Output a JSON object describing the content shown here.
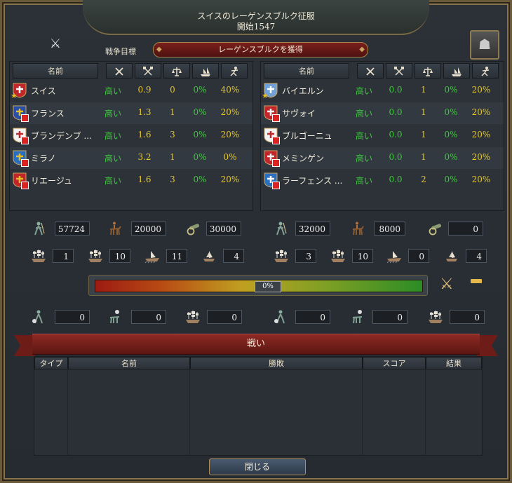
{
  "title": "スイスのレーゲンスブルク征服",
  "subtitle": "開始1547",
  "wargoal": {
    "label": "戦争目標",
    "value": "レーゲンスブルクを獲得"
  },
  "columns": {
    "name": "名前"
  },
  "attackers": [
    {
      "name": "スイス",
      "flag_color": "#c0262a",
      "flag_alt": "#ffffff",
      "leader": true,
      "v1": "高い",
      "v2": "0.9",
      "v3": "0",
      "v4": "0%",
      "v5": "40%"
    },
    {
      "name": "フランス",
      "flag_color": "#2a4fa8",
      "flag_alt": "#e6c020",
      "v1": "高い",
      "v2": "1.3",
      "v3": "1",
      "v4": "0%",
      "v5": "20%"
    },
    {
      "name": "ブランデンブ ...",
      "flag_color": "#f2f2f2",
      "flag_alt": "#c0262a",
      "v1": "高い",
      "v2": "1.6",
      "v3": "3",
      "v4": "0%",
      "v5": "20%"
    },
    {
      "name": "ミラノ",
      "flag_color": "#2a6fc0",
      "flag_alt": "#e6c020",
      "v1": "高い",
      "v2": "3.2",
      "v3": "1",
      "v4": "0%",
      "v5": "0%"
    },
    {
      "name": "リエージュ",
      "flag_color": "#c0262a",
      "flag_alt": "#e6c020",
      "v1": "高い",
      "v2": "1.6",
      "v3": "3",
      "v4": "0%",
      "v5": "20%"
    }
  ],
  "defenders": [
    {
      "name": "バイエルン",
      "flag_color": "#6fa0d8",
      "flag_alt": "#ffffff",
      "leader": true,
      "v1": "高い",
      "v2": "0.0",
      "v3": "1",
      "v4": "0%",
      "v5": "20%"
    },
    {
      "name": "サヴォイ",
      "flag_color": "#c0262a",
      "flag_alt": "#ffffff",
      "v1": "高い",
      "v2": "0.0",
      "v3": "1",
      "v4": "0%",
      "v5": "20%"
    },
    {
      "name": "ブルゴーニュ",
      "flag_color": "#f2f2f2",
      "flag_alt": "#c0262a",
      "v1": "高い",
      "v2": "0.0",
      "v3": "1",
      "v4": "0%",
      "v5": "20%"
    },
    {
      "name": "メミンゲン",
      "flag_color": "#c0262a",
      "flag_alt": "#f2f2f2",
      "v1": "高い",
      "v2": "0.0",
      "v3": "1",
      "v4": "0%",
      "v5": "20%"
    },
    {
      "name": "ラーフェンス ...",
      "flag_color": "#2a6fc0",
      "flag_alt": "#ffffff",
      "v1": "高い",
      "v2": "0.0",
      "v3": "2",
      "v4": "0%",
      "v5": "20%"
    }
  ],
  "attacker_stats": {
    "infantry": "57724",
    "cavalry": "20000",
    "artillery": "30000",
    "heavy_ships": "1",
    "light_ships": "10",
    "galleys": "11",
    "transports": "4",
    "lost_infantry": "0",
    "lost_cavalry": "0",
    "lost_ships": "0"
  },
  "defender_stats": {
    "infantry": "32000",
    "cavalry": "8000",
    "artillery": "0",
    "heavy_ships": "3",
    "light_ships": "10",
    "galleys": "0",
    "transports": "4",
    "lost_infantry": "0",
    "lost_cavalry": "0",
    "lost_ships": "0"
  },
  "warscore": {
    "label": "0%",
    "value": 0
  },
  "battles": {
    "title": "戦い",
    "headers": [
      "タイプ",
      "名前",
      "勝敗",
      "スコア",
      "結果"
    ]
  },
  "close_label": "閉じる"
}
